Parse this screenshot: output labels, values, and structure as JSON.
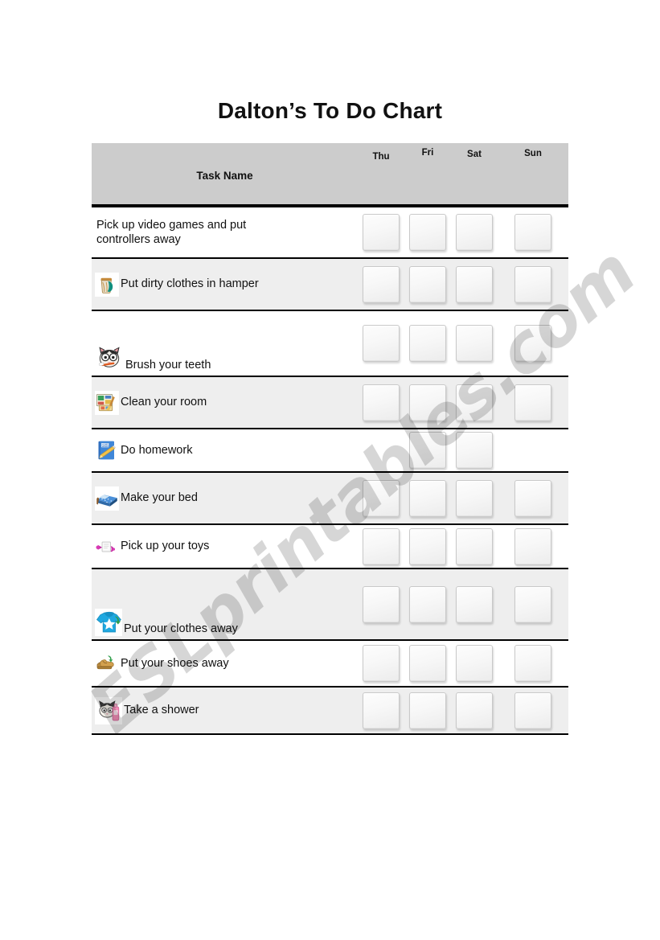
{
  "document": {
    "title": "Dalton’s To Do Chart",
    "watermark": "ESLprintables.com",
    "background_color": "#ffffff"
  },
  "table": {
    "header_background": "#cccccc",
    "shaded_row_background": "#eeeeee",
    "border_color": "#000000",
    "task_column_header": "Task Name",
    "day_columns": [
      "Thu",
      "Fri",
      "Sat",
      "Sun"
    ]
  },
  "rows": [
    {
      "task": "Pick up video games and put\ncontrollers away",
      "icon": "none",
      "checkboxes": [
        true,
        true,
        true,
        true
      ]
    },
    {
      "task": "Put dirty clothes in hamper",
      "icon": "hamper-icon",
      "checkboxes": [
        true,
        true,
        true,
        true
      ]
    },
    {
      "task": "Brush your teeth",
      "icon": "cat-toothbrush-icon",
      "checkboxes": [
        true,
        true,
        true,
        true
      ]
    },
    {
      "task": "Clean your room",
      "icon": "cleaning-supplies-icon",
      "checkboxes": [
        true,
        true,
        true,
        true
      ]
    },
    {
      "task": "Do homework",
      "icon": "homework-book-icon",
      "checkboxes": [
        false,
        true,
        true,
        false
      ]
    },
    {
      "task": "Make your bed",
      "icon": "bed-icon",
      "checkboxes": [
        true,
        true,
        true,
        true
      ]
    },
    {
      "task": "Pick up your toys",
      "icon": "toys-icon",
      "checkboxes": [
        true,
        true,
        true,
        true
      ]
    },
    {
      "task": "Put your clothes away",
      "icon": "tshirt-icon",
      "checkboxes": [
        true,
        true,
        true,
        true
      ]
    },
    {
      "task": "Put your shoes away",
      "icon": "shoes-icon",
      "checkboxes": [
        true,
        true,
        true,
        true
      ]
    },
    {
      "task": "Take a shower",
      "icon": "cat-shower-icon",
      "checkboxes": [
        true,
        true,
        true,
        true
      ]
    }
  ]
}
